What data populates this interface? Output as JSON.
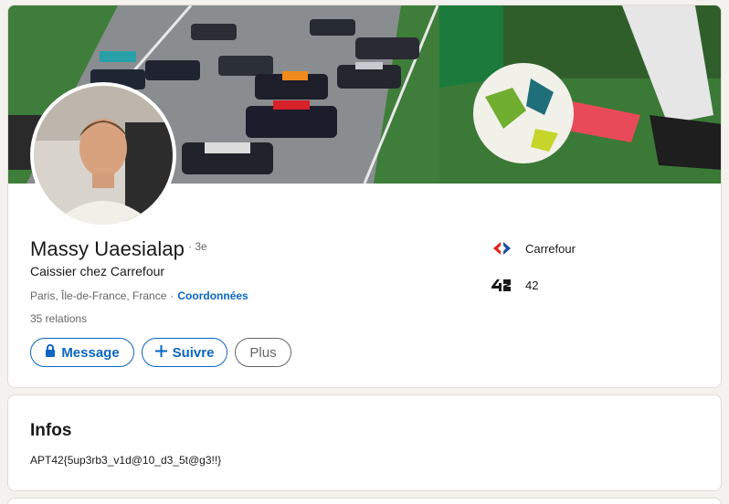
{
  "profile": {
    "name": "Massy Uaesialap",
    "degree": "· 3e",
    "headline": "Caissier chez Carrefour",
    "location": "Paris, Île-de-France, France",
    "location_sep": "·",
    "contact_link": "Coordonnées",
    "connections": "35 relations"
  },
  "actions": {
    "message_label": "Message",
    "follow_label": "Suivre",
    "more_label": "Plus",
    "message_icon": "lock-icon",
    "follow_icon": "plus-icon"
  },
  "companies": [
    {
      "name": "Carrefour",
      "logo": "carrefour-logo"
    },
    {
      "name": "42",
      "logo": "42-logo"
    }
  ],
  "infos": {
    "title": "Infos",
    "text": "APT42{5up3rb3_v1d@10_d3_5t@g3!!}"
  },
  "colors": {
    "accent": "#0a66c2",
    "background": "#f4f2ee",
    "card": "#ffffff",
    "muted_text": "#666666",
    "carrefour_red": "#e1251b",
    "carrefour_blue": "#1c4fa0"
  }
}
